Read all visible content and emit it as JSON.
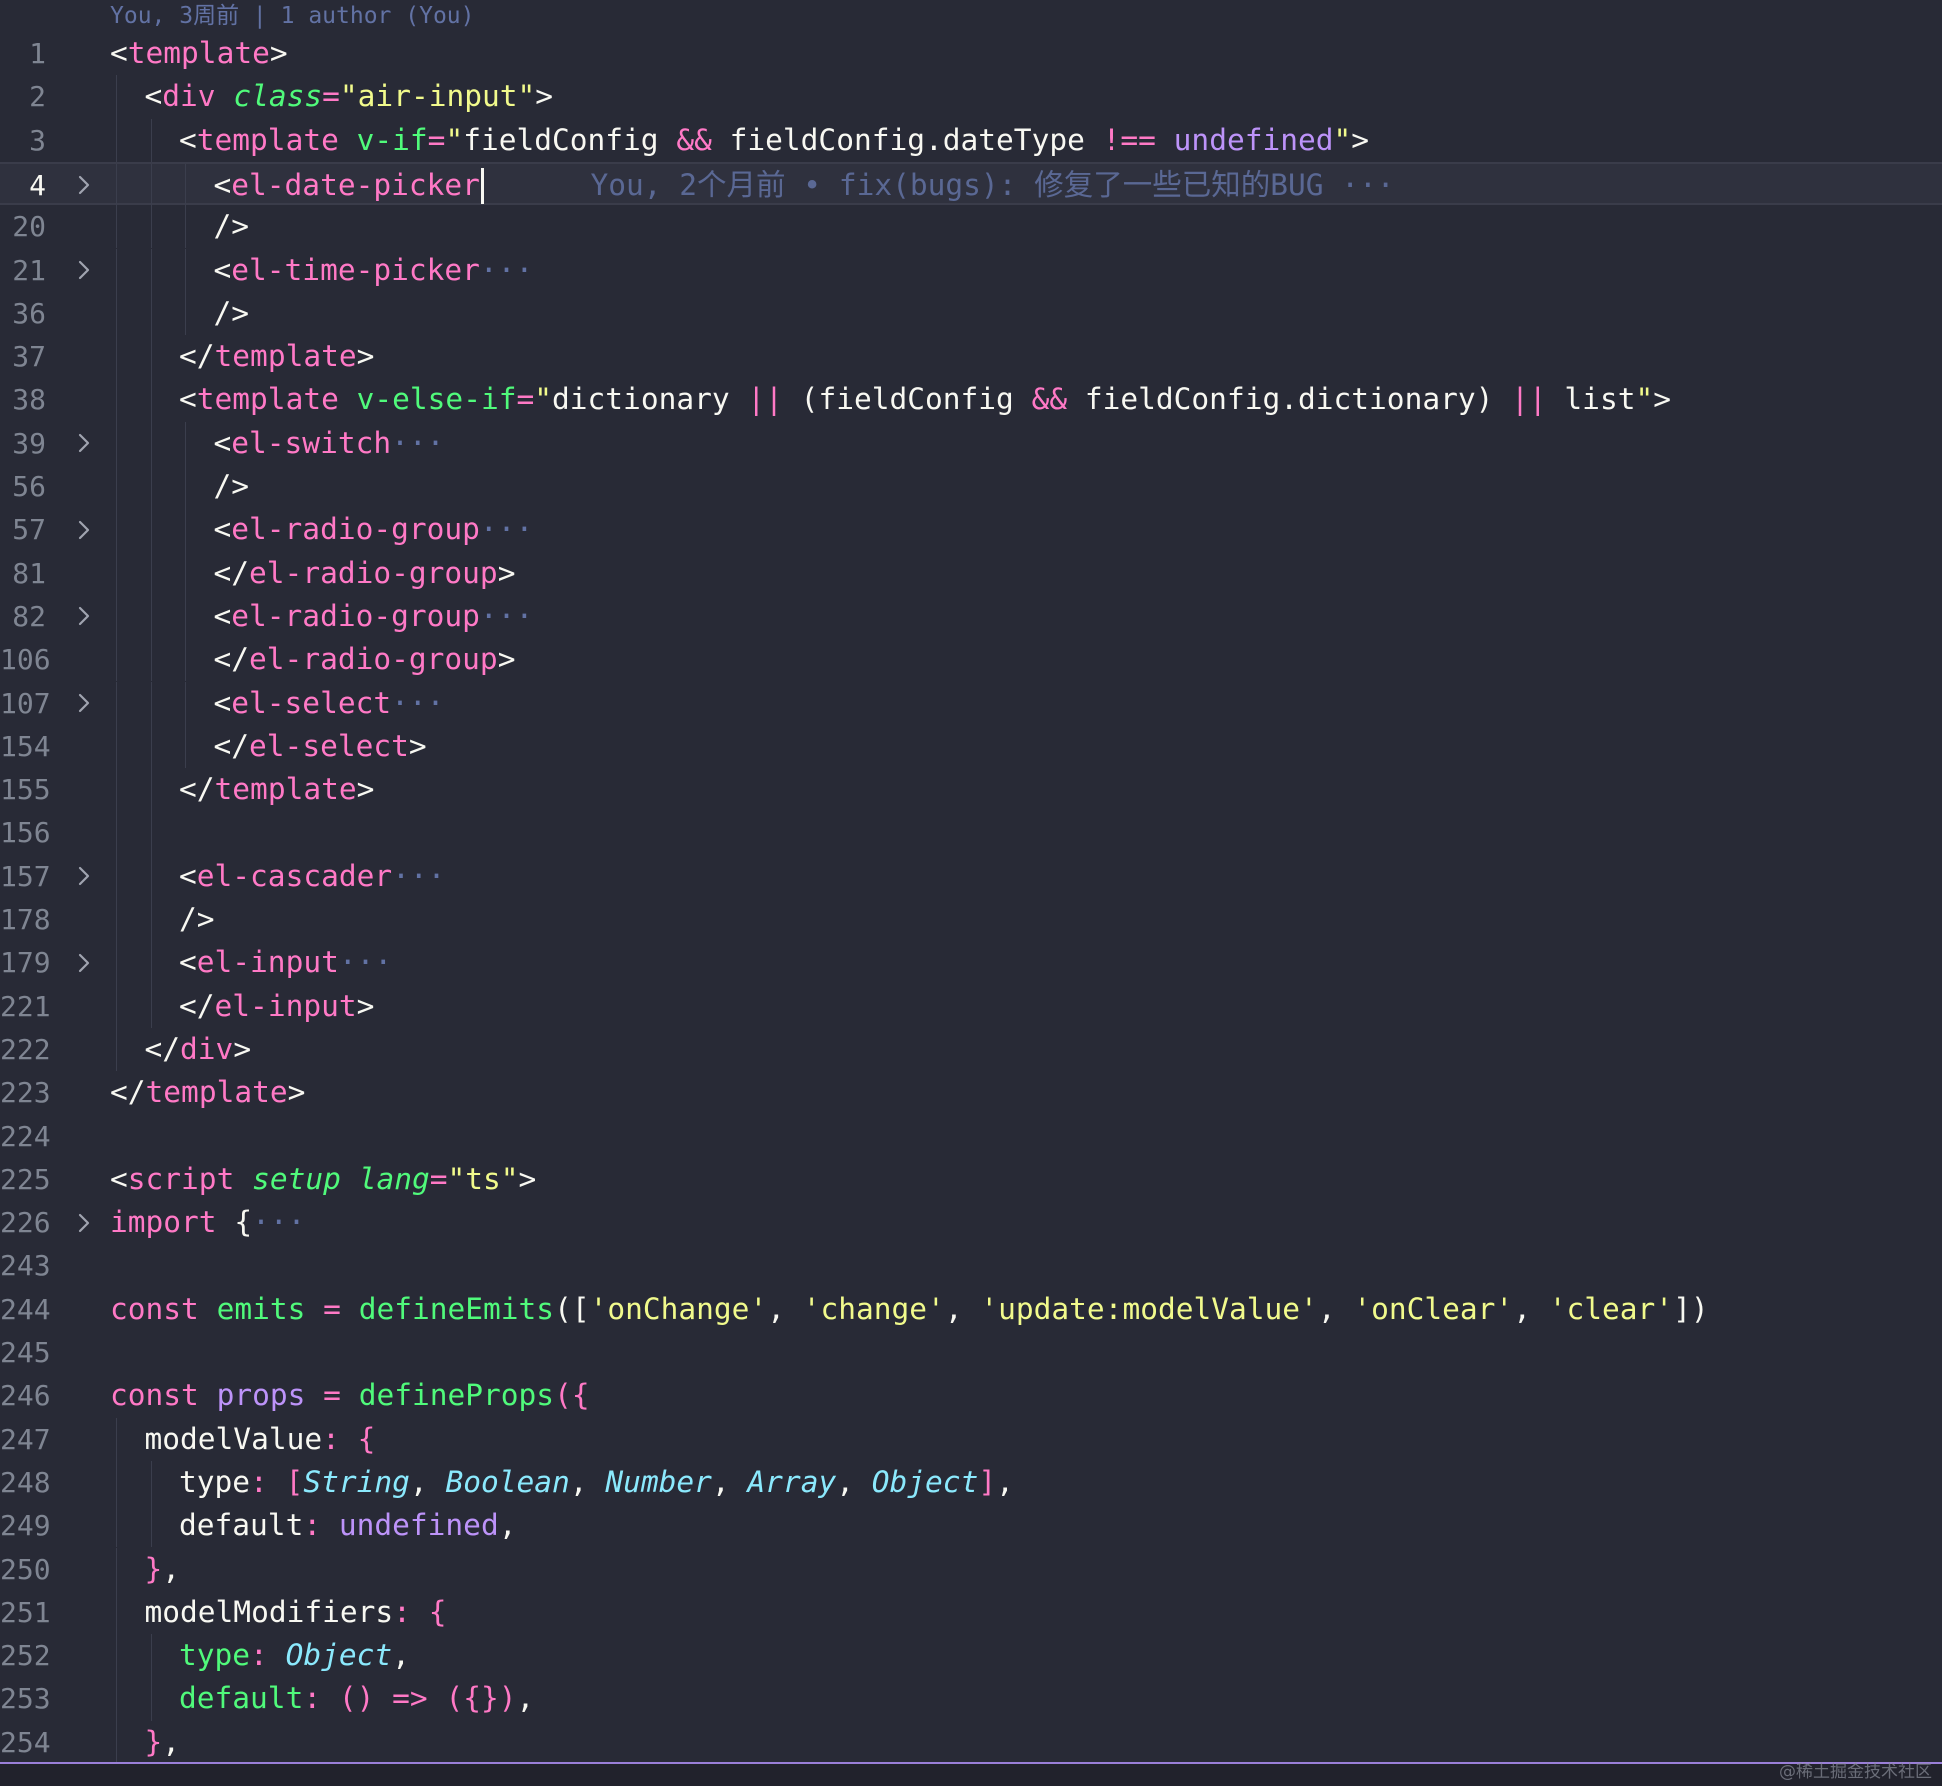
{
  "blame_header": "You, 3周前 | 1 author (You)",
  "inline_blame": "You, 2个月前 • fix(bugs): 修复了一些已知的BUG ···",
  "watermark": "@稀土掘金技术社区",
  "theme": {
    "background": "#282a36",
    "tag": "#ff79c6",
    "attribute": "#50fa7b",
    "string": "#f1fa8c",
    "constant": "#bd93f9",
    "type": "#8be9fd",
    "comment": "#6272a4"
  },
  "lines": [
    {
      "n": "1",
      "fold": false,
      "indent": 0,
      "current": false,
      "tokens": [
        [
          "<",
          "t-punc"
        ],
        [
          "template",
          "t-tag"
        ],
        [
          ">",
          "t-punc"
        ]
      ]
    },
    {
      "n": "2",
      "fold": false,
      "indent": 1,
      "current": false,
      "tokens": [
        [
          "<",
          "t-punc"
        ],
        [
          "div",
          "t-tag"
        ],
        [
          " ",
          "t-punc"
        ],
        [
          "class",
          "t-attr-i"
        ],
        [
          "=",
          "t-op"
        ],
        [
          "\"air-input\"",
          "t-str"
        ],
        [
          ">",
          "t-punc"
        ]
      ]
    },
    {
      "n": "3",
      "fold": false,
      "indent": 2,
      "current": false,
      "tokens": [
        [
          "<",
          "t-punc"
        ],
        [
          "template",
          "t-tag"
        ],
        [
          " ",
          "t-punc"
        ],
        [
          "v-if",
          "t-attr"
        ],
        [
          "=",
          "t-op"
        ],
        [
          "\"",
          "t-str"
        ],
        [
          "fieldConfig",
          "t-var"
        ],
        [
          " && ",
          "t-op"
        ],
        [
          "fieldConfig",
          "t-var"
        ],
        [
          ".",
          "t-punc"
        ],
        [
          "dateType",
          "t-var"
        ],
        [
          " !== ",
          "t-op"
        ],
        [
          "undefined",
          "t-const"
        ],
        [
          "\"",
          "t-str"
        ],
        [
          ">",
          "t-punc"
        ]
      ]
    },
    {
      "n": "4",
      "fold": true,
      "indent": 3,
      "current": true,
      "tokens": [
        [
          "<",
          "t-punc"
        ],
        [
          "el-date-picker",
          "t-tag"
        ]
      ]
    },
    {
      "n": "20",
      "fold": false,
      "indent": 3,
      "current": false,
      "tokens": [
        [
          "/>",
          "t-punc"
        ]
      ]
    },
    {
      "n": "21",
      "fold": true,
      "indent": 3,
      "current": false,
      "tokens": [
        [
          "<",
          "t-punc"
        ],
        [
          "el-time-picker",
          "t-tag"
        ],
        [
          "···",
          "t-fold"
        ]
      ]
    },
    {
      "n": "36",
      "fold": false,
      "indent": 3,
      "current": false,
      "tokens": [
        [
          "/>",
          "t-punc"
        ]
      ]
    },
    {
      "n": "37",
      "fold": false,
      "indent": 2,
      "current": false,
      "tokens": [
        [
          "</",
          "t-punc"
        ],
        [
          "template",
          "t-tag"
        ],
        [
          ">",
          "t-punc"
        ]
      ]
    },
    {
      "n": "38",
      "fold": false,
      "indent": 2,
      "current": false,
      "tokens": [
        [
          "<",
          "t-punc"
        ],
        [
          "template",
          "t-tag"
        ],
        [
          " ",
          "t-punc"
        ],
        [
          "v-else-if",
          "t-attr"
        ],
        [
          "=",
          "t-op"
        ],
        [
          "\"",
          "t-str"
        ],
        [
          "dictionary",
          "t-var"
        ],
        [
          " || ",
          "t-op"
        ],
        [
          "(",
          "t-punc"
        ],
        [
          "fieldConfig",
          "t-var"
        ],
        [
          " && ",
          "t-op"
        ],
        [
          "fieldConfig",
          "t-var"
        ],
        [
          ".",
          "t-punc"
        ],
        [
          "dictionary",
          "t-var"
        ],
        [
          ")",
          "t-punc"
        ],
        [
          " || ",
          "t-op"
        ],
        [
          "list",
          "t-var"
        ],
        [
          "\"",
          "t-str"
        ],
        [
          ">",
          "t-punc"
        ]
      ]
    },
    {
      "n": "39",
      "fold": true,
      "indent": 3,
      "current": false,
      "tokens": [
        [
          "<",
          "t-punc"
        ],
        [
          "el-switch",
          "t-tag"
        ],
        [
          "···",
          "t-fold"
        ]
      ]
    },
    {
      "n": "56",
      "fold": false,
      "indent": 3,
      "current": false,
      "tokens": [
        [
          "/>",
          "t-punc"
        ]
      ]
    },
    {
      "n": "57",
      "fold": true,
      "indent": 3,
      "current": false,
      "tokens": [
        [
          "<",
          "t-punc"
        ],
        [
          "el-radio-group",
          "t-tag"
        ],
        [
          "···",
          "t-fold"
        ]
      ]
    },
    {
      "n": "81",
      "fold": false,
      "indent": 3,
      "current": false,
      "tokens": [
        [
          "</",
          "t-punc"
        ],
        [
          "el-radio-group",
          "t-tag"
        ],
        [
          ">",
          "t-punc"
        ]
      ]
    },
    {
      "n": "82",
      "fold": true,
      "indent": 3,
      "current": false,
      "tokens": [
        [
          "<",
          "t-punc"
        ],
        [
          "el-radio-group",
          "t-tag"
        ],
        [
          "···",
          "t-fold"
        ]
      ]
    },
    {
      "n": "106",
      "fold": false,
      "indent": 3,
      "current": false,
      "tokens": [
        [
          "</",
          "t-punc"
        ],
        [
          "el-radio-group",
          "t-tag"
        ],
        [
          ">",
          "t-punc"
        ]
      ]
    },
    {
      "n": "107",
      "fold": true,
      "indent": 3,
      "current": false,
      "tokens": [
        [
          "<",
          "t-punc"
        ],
        [
          "el-select",
          "t-tag"
        ],
        [
          "···",
          "t-fold"
        ]
      ]
    },
    {
      "n": "154",
      "fold": false,
      "indent": 3,
      "current": false,
      "tokens": [
        [
          "</",
          "t-punc"
        ],
        [
          "el-select",
          "t-tag"
        ],
        [
          ">",
          "t-punc"
        ]
      ]
    },
    {
      "n": "155",
      "fold": false,
      "indent": 2,
      "current": false,
      "tokens": [
        [
          "</",
          "t-punc"
        ],
        [
          "template",
          "t-tag"
        ],
        [
          ">",
          "t-punc"
        ]
      ]
    },
    {
      "n": "156",
      "fold": false,
      "indent": 2,
      "current": false,
      "tokens": []
    },
    {
      "n": "157",
      "fold": true,
      "indent": 2,
      "current": false,
      "tokens": [
        [
          "<",
          "t-punc"
        ],
        [
          "el-cascader",
          "t-tag"
        ],
        [
          "···",
          "t-fold"
        ]
      ]
    },
    {
      "n": "178",
      "fold": false,
      "indent": 2,
      "current": false,
      "tokens": [
        [
          "/>",
          "t-punc"
        ]
      ]
    },
    {
      "n": "179",
      "fold": true,
      "indent": 2,
      "current": false,
      "tokens": [
        [
          "<",
          "t-punc"
        ],
        [
          "el-input",
          "t-tag"
        ],
        [
          "···",
          "t-fold"
        ]
      ]
    },
    {
      "n": "221",
      "fold": false,
      "indent": 2,
      "current": false,
      "tokens": [
        [
          "</",
          "t-punc"
        ],
        [
          "el-input",
          "t-tag"
        ],
        [
          ">",
          "t-punc"
        ]
      ]
    },
    {
      "n": "222",
      "fold": false,
      "indent": 1,
      "current": false,
      "tokens": [
        [
          "</",
          "t-punc"
        ],
        [
          "div",
          "t-tag"
        ],
        [
          ">",
          "t-punc"
        ]
      ]
    },
    {
      "n": "223",
      "fold": false,
      "indent": 0,
      "current": false,
      "tokens": [
        [
          "</",
          "t-punc"
        ],
        [
          "template",
          "t-tag"
        ],
        [
          ">",
          "t-punc"
        ]
      ]
    },
    {
      "n": "224",
      "fold": false,
      "indent": 0,
      "current": false,
      "tokens": []
    },
    {
      "n": "225",
      "fold": false,
      "indent": 0,
      "current": false,
      "tokens": [
        [
          "<",
          "t-punc"
        ],
        [
          "script",
          "t-tag"
        ],
        [
          " ",
          "t-punc"
        ],
        [
          "setup",
          "t-attr-i"
        ],
        [
          " ",
          "t-punc"
        ],
        [
          "lang",
          "t-attr-i"
        ],
        [
          "=",
          "t-op"
        ],
        [
          "\"ts\"",
          "t-str"
        ],
        [
          ">",
          "t-punc"
        ]
      ]
    },
    {
      "n": "226",
      "fold": true,
      "indent": 0,
      "current": false,
      "tokens": [
        [
          "import",
          "t-kw"
        ],
        [
          " {",
          "t-punc"
        ],
        [
          "···",
          "t-fold"
        ]
      ]
    },
    {
      "n": "243",
      "fold": false,
      "indent": 0,
      "current": false,
      "tokens": []
    },
    {
      "n": "244",
      "fold": false,
      "indent": 0,
      "current": false,
      "tokens": [
        [
          "const",
          "t-kw"
        ],
        [
          " ",
          "t-punc"
        ],
        [
          "emits",
          "t-fn"
        ],
        [
          " = ",
          "t-op"
        ],
        [
          "defineEmits",
          "t-fn"
        ],
        [
          "([",
          "t-punc"
        ],
        [
          "'onChange'",
          "t-str"
        ],
        [
          ", ",
          "t-punc"
        ],
        [
          "'change'",
          "t-str"
        ],
        [
          ", ",
          "t-punc"
        ],
        [
          "'update:modelValue'",
          "t-str"
        ],
        [
          ", ",
          "t-punc"
        ],
        [
          "'onClear'",
          "t-str"
        ],
        [
          ", ",
          "t-punc"
        ],
        [
          "'clear'",
          "t-str"
        ],
        [
          "])",
          "t-punc"
        ]
      ]
    },
    {
      "n": "245",
      "fold": false,
      "indent": 0,
      "current": false,
      "tokens": []
    },
    {
      "n": "246",
      "fold": false,
      "indent": 0,
      "current": false,
      "tokens": [
        [
          "const",
          "t-kw"
        ],
        [
          " ",
          "t-punc"
        ],
        [
          "props",
          "t-const"
        ],
        [
          " = ",
          "t-op"
        ],
        [
          "defineProps",
          "t-fn"
        ],
        [
          "({",
          "t-bracket"
        ]
      ]
    },
    {
      "n": "247",
      "fold": false,
      "indent": 1,
      "current": false,
      "tokens": [
        [
          "modelValue",
          "t-prop"
        ],
        [
          ": ",
          "t-op"
        ],
        [
          "{",
          "t-bracket"
        ]
      ]
    },
    {
      "n": "248",
      "fold": false,
      "indent": 2,
      "current": false,
      "tokens": [
        [
          "type",
          "t-prop"
        ],
        [
          ": ",
          "t-op"
        ],
        [
          "[",
          "t-bracket"
        ],
        [
          "String",
          "t-type"
        ],
        [
          ", ",
          "t-punc"
        ],
        [
          "Boolean",
          "t-type"
        ],
        [
          ", ",
          "t-punc"
        ],
        [
          "Number",
          "t-type"
        ],
        [
          ", ",
          "t-punc"
        ],
        [
          "Array",
          "t-type"
        ],
        [
          ", ",
          "t-punc"
        ],
        [
          "Object",
          "t-type"
        ],
        [
          "]",
          "t-bracket"
        ],
        [
          ",",
          "t-punc"
        ]
      ]
    },
    {
      "n": "249",
      "fold": false,
      "indent": 2,
      "current": false,
      "tokens": [
        [
          "default",
          "t-prop"
        ],
        [
          ": ",
          "t-op"
        ],
        [
          "undefined",
          "t-const"
        ],
        [
          ",",
          "t-punc"
        ]
      ]
    },
    {
      "n": "250",
      "fold": false,
      "indent": 1,
      "current": false,
      "tokens": [
        [
          "}",
          "t-bracket"
        ],
        [
          ",",
          "t-punc"
        ]
      ]
    },
    {
      "n": "251",
      "fold": false,
      "indent": 1,
      "current": false,
      "tokens": [
        [
          "modelModifiers",
          "t-prop"
        ],
        [
          ": ",
          "t-op"
        ],
        [
          "{",
          "t-bracket"
        ]
      ]
    },
    {
      "n": "252",
      "fold": false,
      "indent": 2,
      "current": false,
      "tokens": [
        [
          "type",
          "t-prop-green"
        ],
        [
          ": ",
          "t-op"
        ],
        [
          "Object",
          "t-type"
        ],
        [
          ",",
          "t-punc"
        ]
      ]
    },
    {
      "n": "253",
      "fold": false,
      "indent": 2,
      "current": false,
      "tokens": [
        [
          "default",
          "t-prop-green"
        ],
        [
          ": ",
          "t-op"
        ],
        [
          "()",
          "t-bracket"
        ],
        [
          " => ",
          "t-op"
        ],
        [
          "({})",
          "t-bracket"
        ],
        [
          ",",
          "t-punc"
        ]
      ]
    },
    {
      "n": "254",
      "fold": false,
      "indent": 1,
      "current": false,
      "tokens": [
        [
          "}",
          "t-bracket"
        ],
        [
          ",",
          "t-punc"
        ]
      ]
    }
  ]
}
